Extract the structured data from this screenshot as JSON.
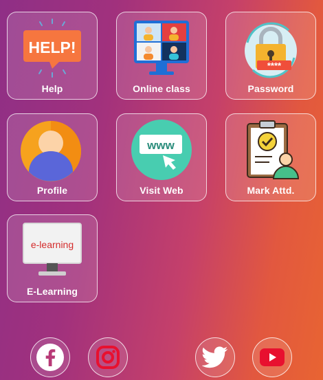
{
  "tiles": [
    {
      "id": "help",
      "label": "Help"
    },
    {
      "id": "online-class",
      "label": "Online class"
    },
    {
      "id": "password",
      "label": "Password"
    },
    {
      "id": "profile",
      "label": "Profile"
    },
    {
      "id": "visit-web",
      "label": "Visit Web"
    },
    {
      "id": "mark-attd",
      "label": "Mark Attd."
    },
    {
      "id": "e-learning",
      "label": "E-Learning"
    }
  ],
  "icon_text": {
    "help": "HELP!",
    "password": "****",
    "www": "www",
    "elearning": "e-learning"
  },
  "social": [
    "facebook-icon",
    "instagram-icon",
    "twitter-icon",
    "youtube-icon"
  ],
  "colors": {
    "facebook": "#ffffff",
    "instagram": "#e8102f",
    "twitter": "#ffffff",
    "youtube": "#e8102f"
  }
}
